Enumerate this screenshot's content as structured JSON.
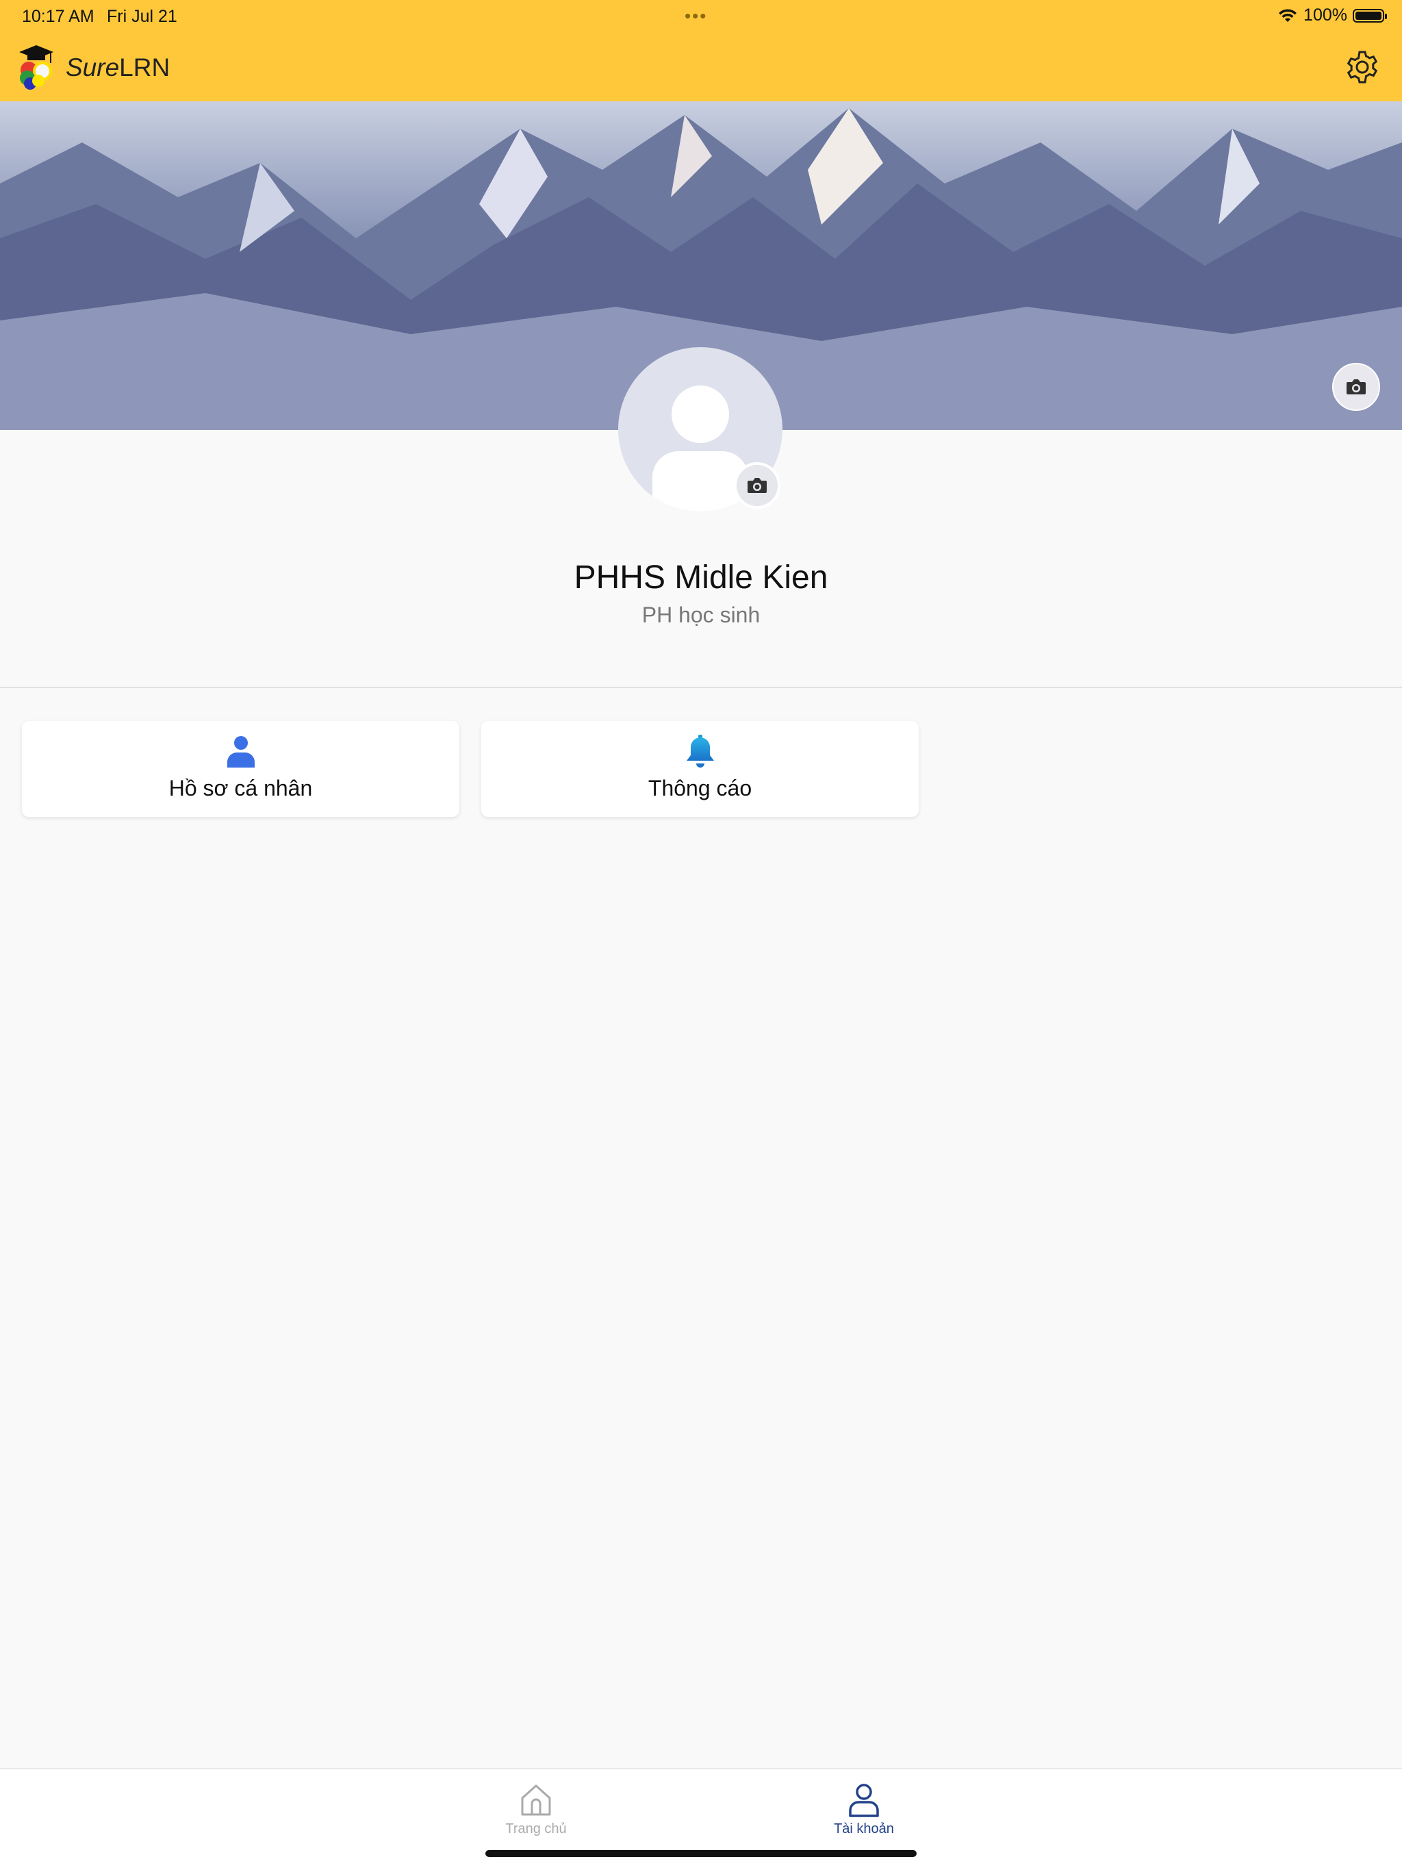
{
  "status_bar": {
    "time": "10:17 AM",
    "date": "Fri Jul 21",
    "dots": "•••",
    "battery": "100%"
  },
  "app_bar": {
    "name_italic": "Sure",
    "name_bold": "LRN",
    "settings_icon": "gear-icon",
    "accent_color": "#ffc83a"
  },
  "profile": {
    "name": "PHHS Midle Kien",
    "role": "PH học sinh"
  },
  "cards": [
    {
      "label": "Hồ sơ cá nhân",
      "icon": "person-icon",
      "color": "#3a6fe6"
    },
    {
      "label": "Thông cáo",
      "icon": "bell-icon",
      "color": "#1e9ad6"
    }
  ],
  "tabs": [
    {
      "label": "Trang chủ",
      "icon": "home-icon",
      "active": false,
      "color": "#aaaaaa"
    },
    {
      "label": "Tài khoản",
      "icon": "user-icon",
      "active": true,
      "color": "#22418a"
    }
  ]
}
